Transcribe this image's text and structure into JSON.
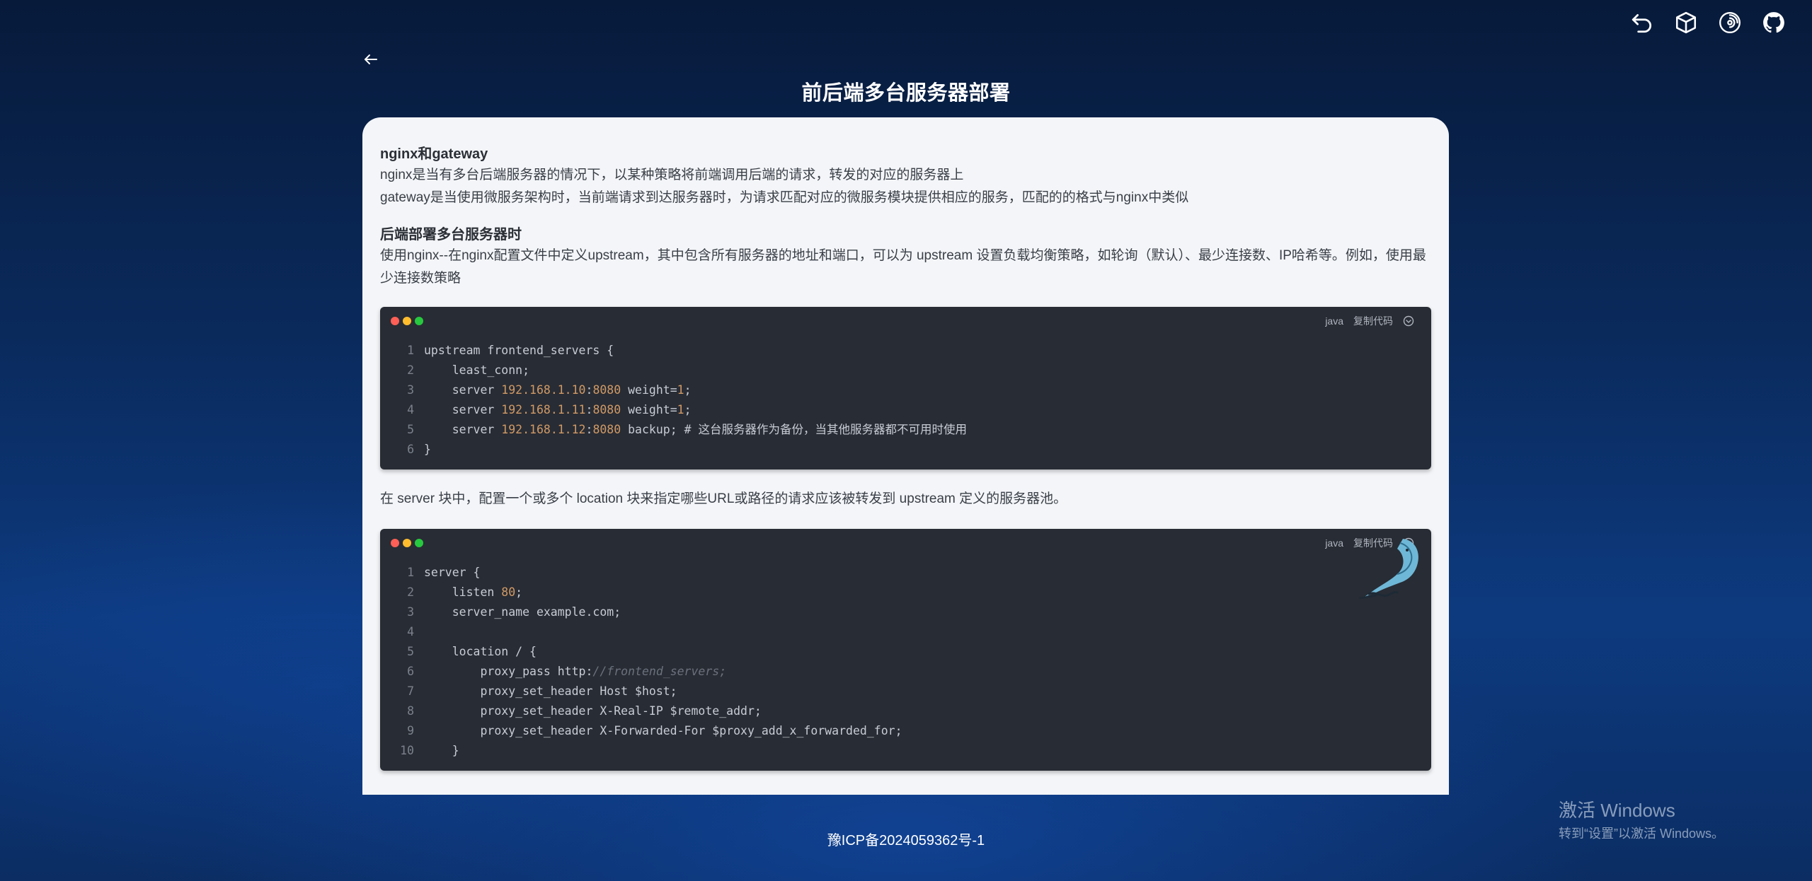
{
  "page": {
    "title": "前后端多台服务器部署",
    "footer": "豫ICP备2024059362号-1"
  },
  "top_icons": [
    "undo-icon",
    "cube-icon",
    "spiral-icon",
    "github-icon"
  ],
  "article": {
    "h1": "nginx和gateway",
    "p1_line1": "nginx是当有多台后端服务器的情况下，以某种策略将前端调用后端的请求，转发的对应的服务器上",
    "p1_line2": "gateway是当使用微服务架构时，当前端请求到达服务器时，为请求匹配对应的微服务模块提供相应的服务，匹配的的格式与nginx中类似",
    "h2": "后端部署多台服务器时",
    "p2": "使用nginx--在nginx配置文件中定义upstream，其中包含所有服务器的地址和端口，可以为 upstream 设置负载均衡策略，如轮询（默认）、最少连接数、IP哈希等。例如，使用最少连接数策略",
    "p3": "在 server 块中，配置一个或多个 location 块来指定哪些URL或路径的请求应该被转发到 upstream 定义的服务器池。"
  },
  "code_blocks": [
    {
      "lang": "java",
      "copy_label": "复制代码",
      "lines": [
        {
          "n": "1",
          "parts": [
            [
              "t",
              "upstream frontend_servers {"
            ]
          ]
        },
        {
          "n": "2",
          "parts": [
            [
              "t",
              "    least_conn;"
            ]
          ]
        },
        {
          "n": "3",
          "parts": [
            [
              "t",
              "    server "
            ],
            [
              "num",
              "192.168.1.10"
            ],
            [
              "t",
              ":"
            ],
            [
              "num",
              "8080"
            ],
            [
              "t",
              " weight="
            ],
            [
              "num",
              "1"
            ],
            [
              "t",
              ";"
            ]
          ]
        },
        {
          "n": "4",
          "parts": [
            [
              "t",
              "    server "
            ],
            [
              "num",
              "192.168.1.11"
            ],
            [
              "t",
              ":"
            ],
            [
              "num",
              "8080"
            ],
            [
              "t",
              " weight="
            ],
            [
              "num",
              "1"
            ],
            [
              "t",
              ";"
            ]
          ]
        },
        {
          "n": "5",
          "parts": [
            [
              "t",
              "    server "
            ],
            [
              "num",
              "192.168.1.12"
            ],
            [
              "t",
              ":"
            ],
            [
              "num",
              "8080"
            ],
            [
              "t",
              " backup; # 这台服务器作为备份，当其他服务器都不可用时使用"
            ]
          ]
        },
        {
          "n": "6",
          "parts": [
            [
              "t",
              "}"
            ]
          ]
        }
      ]
    },
    {
      "lang": "java",
      "copy_label": "复制代码",
      "lines": [
        {
          "n": "1",
          "parts": [
            [
              "t",
              "server {"
            ]
          ]
        },
        {
          "n": "2",
          "parts": [
            [
              "t",
              "    listen "
            ],
            [
              "num",
              "80"
            ],
            [
              "t",
              ";"
            ]
          ]
        },
        {
          "n": "3",
          "parts": [
            [
              "t",
              "    server_name example.com;"
            ]
          ]
        },
        {
          "n": "4",
          "parts": [
            [
              "t",
              ""
            ]
          ]
        },
        {
          "n": "5",
          "parts": [
            [
              "t",
              "    location / {"
            ]
          ]
        },
        {
          "n": "6",
          "parts": [
            [
              "t",
              "        proxy_pass http:"
            ],
            [
              "cmt",
              "//frontend_servers;"
            ]
          ]
        },
        {
          "n": "7",
          "parts": [
            [
              "t",
              "        proxy_set_header Host $host;"
            ]
          ]
        },
        {
          "n": "8",
          "parts": [
            [
              "t",
              "        proxy_set_header X-Real-IP $remote_addr;"
            ]
          ]
        },
        {
          "n": "9",
          "parts": [
            [
              "t",
              "        proxy_set_header X-Forwarded-For $proxy_add_x_forwarded_for;"
            ]
          ]
        },
        {
          "n": "10",
          "parts": [
            [
              "t",
              "    }"
            ]
          ]
        }
      ]
    }
  ],
  "windows_watermark": {
    "line1": "激活 Windows",
    "line2": "转到“设置”以激活 Windows。"
  }
}
